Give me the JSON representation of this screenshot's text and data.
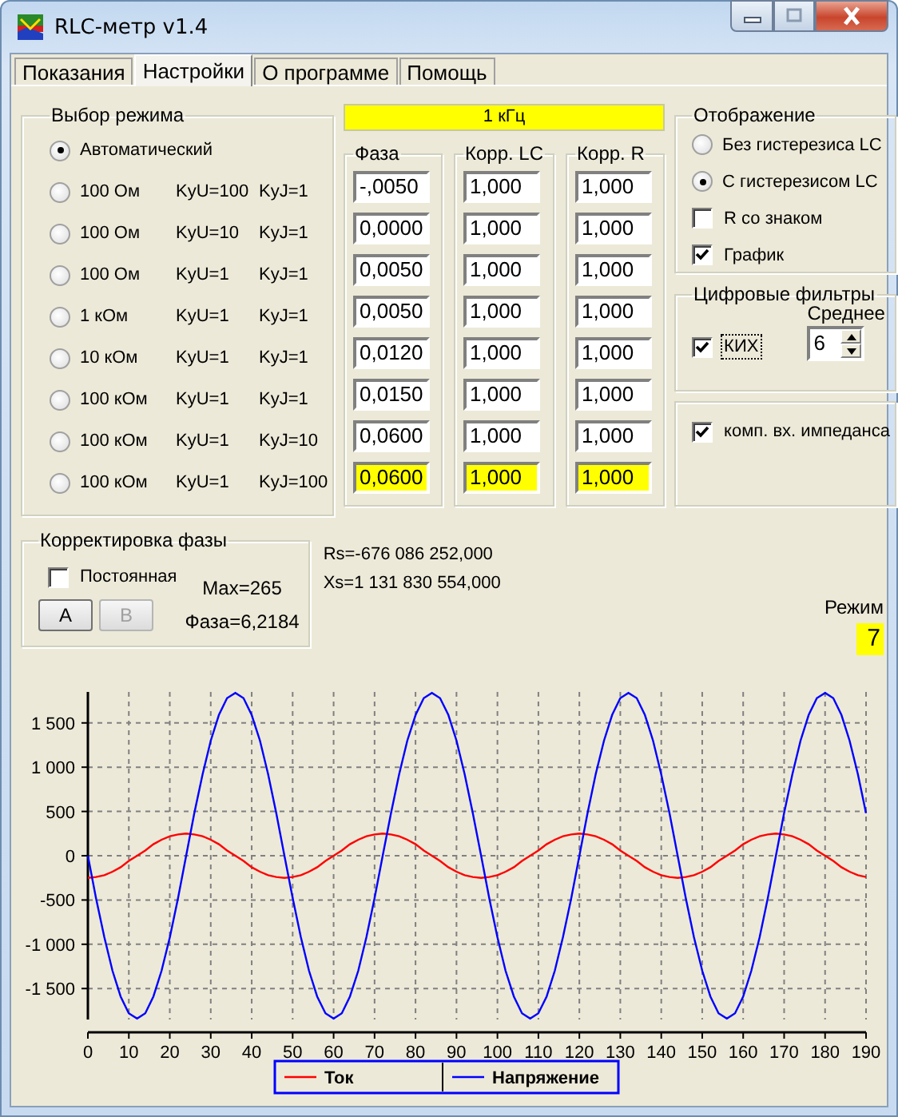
{
  "window": {
    "title": "RLC-метр v1.4"
  },
  "tabs": [
    {
      "label": "Показания",
      "selected": false
    },
    {
      "label": "Настройки",
      "selected": true
    },
    {
      "label": "О программе",
      "selected": false
    },
    {
      "label": "Помощь",
      "selected": false
    }
  ],
  "mode_group": {
    "title": "Выбор режима",
    "options": [
      {
        "parts": [
          "Автоматический"
        ],
        "selected": true
      },
      {
        "parts": [
          "100 Ом",
          "KyU=100",
          "KyJ=1"
        ],
        "selected": false
      },
      {
        "parts": [
          "100 Ом",
          "KyU=10",
          "KyJ=1"
        ],
        "selected": false
      },
      {
        "parts": [
          "100 Ом",
          "KyU=1",
          "KyJ=1"
        ],
        "selected": false
      },
      {
        "parts": [
          "1 кОм",
          "KyU=1",
          "KyJ=1"
        ],
        "selected": false
      },
      {
        "parts": [
          "10 кОм",
          "KyU=1",
          "KyJ=1"
        ],
        "selected": false
      },
      {
        "parts": [
          "100 кОм",
          "KyU=1",
          "KyJ=1"
        ],
        "selected": false
      },
      {
        "parts": [
          "100 кОм",
          "KyU=1",
          "KyJ=10"
        ],
        "selected": false
      },
      {
        "parts": [
          "100 кОм",
          "KyU=1",
          "KyJ=100"
        ],
        "selected": false
      }
    ]
  },
  "frequency": "1 кГц",
  "coefficient_groups": [
    {
      "title": "Фаза",
      "values": [
        {
          "value": "-,0050",
          "highlighted": false
        },
        {
          "value": "0,0000",
          "highlighted": false
        },
        {
          "value": "0,0050",
          "highlighted": false
        },
        {
          "value": "0,0050",
          "highlighted": false
        },
        {
          "value": "0,0120",
          "highlighted": false
        },
        {
          "value": "0,0150",
          "highlighted": false
        },
        {
          "value": "0,0600",
          "highlighted": false
        },
        {
          "value": "0,0600",
          "highlighted": true
        }
      ]
    },
    {
      "title": "Корр. LC",
      "values": [
        {
          "value": "1,000",
          "highlighted": false
        },
        {
          "value": "1,000",
          "highlighted": false
        },
        {
          "value": "1,000",
          "highlighted": false
        },
        {
          "value": "1,000",
          "highlighted": false
        },
        {
          "value": "1,000",
          "highlighted": false
        },
        {
          "value": "1,000",
          "highlighted": false
        },
        {
          "value": "1,000",
          "highlighted": false
        },
        {
          "value": "1,000",
          "highlighted": true
        }
      ]
    },
    {
      "title": "Корр. R",
      "values": [
        {
          "value": "1,000",
          "highlighted": false
        },
        {
          "value": "1,000",
          "highlighted": false
        },
        {
          "value": "1,000",
          "highlighted": false
        },
        {
          "value": "1,000",
          "highlighted": false
        },
        {
          "value": "1,000",
          "highlighted": false
        },
        {
          "value": "1,000",
          "highlighted": false
        },
        {
          "value": "1,000",
          "highlighted": false
        },
        {
          "value": "1,000",
          "highlighted": true
        }
      ]
    }
  ],
  "display_group": {
    "title": "Отображение",
    "options": [
      {
        "kind": "radio",
        "label": "Без гистерезиса LC",
        "selected": false
      },
      {
        "kind": "radio",
        "label": "С гистерезисом LC",
        "selected": true
      },
      {
        "kind": "checkbox",
        "label": "R со знаком",
        "checked": false
      },
      {
        "kind": "checkbox",
        "label": "График",
        "checked": true
      }
    ]
  },
  "filters_group": {
    "title": "Цифровые фильтры",
    "fir": {
      "label": "КИХ",
      "checked": true,
      "focused": true
    },
    "average": {
      "label": "Среднее",
      "value": "6"
    }
  },
  "impedance": {
    "label": "комп. вх. импеданса",
    "checked": true
  },
  "phase_correction": {
    "title": "Корректировка фазы",
    "constant": {
      "label": "Постоянная",
      "checked": false
    },
    "buttons": [
      {
        "label": "A",
        "disabled": false
      },
      {
        "label": "B",
        "disabled": true
      }
    ],
    "max": "Max=265",
    "phase": "Фаза=6,2184"
  },
  "results": [
    "Rs=-676 086 252,000",
    "Xs=1 131 830 554,000"
  ],
  "mode": {
    "label": "Режим",
    "value": "7"
  },
  "chart": {
    "chart_data": {
      "type": "line",
      "x": [
        0,
        2,
        4,
        6,
        8,
        10,
        12,
        14,
        16,
        18,
        20,
        22,
        24,
        26,
        28,
        30,
        32,
        34,
        36,
        38,
        40,
        42,
        44,
        46,
        48,
        50,
        52,
        54,
        56,
        58,
        60,
        62,
        64,
        66,
        68,
        70,
        72,
        74,
        76,
        78,
        80,
        82,
        84,
        86,
        88,
        90,
        92,
        94,
        96,
        98,
        100,
        102,
        104,
        106,
        108,
        110,
        112,
        114,
        116,
        118,
        120,
        122,
        124,
        126,
        128,
        130,
        132,
        134,
        136,
        138,
        140,
        142,
        144,
        146,
        148,
        150,
        152,
        154,
        156,
        158,
        160,
        162,
        164,
        166,
        168,
        170,
        172,
        174,
        176,
        178,
        180,
        182,
        184,
        186,
        188,
        190
      ],
      "series": [
        {
          "name": "Ток",
          "color": "#ff0000",
          "values": [
            -250,
            -240,
            -220,
            -180,
            -130,
            -60,
            0,
            60,
            130,
            180,
            220,
            240,
            250,
            240,
            220,
            180,
            130,
            60,
            0,
            -60,
            -130,
            -180,
            -220,
            -240,
            -250,
            -240,
            -220,
            -180,
            -130,
            -60,
            0,
            60,
            130,
            180,
            220,
            240,
            250,
            240,
            220,
            180,
            130,
            60,
            0,
            -60,
            -130,
            -180,
            -220,
            -240,
            -250,
            -240,
            -220,
            -180,
            -130,
            -60,
            0,
            60,
            130,
            180,
            220,
            240,
            250,
            240,
            220,
            180,
            130,
            60,
            0,
            -60,
            -130,
            -180,
            -220,
            -240,
            -250,
            -240,
            -220,
            -180,
            -130,
            -60,
            0,
            60,
            130,
            180,
            220,
            240,
            250,
            240,
            220,
            180,
            130,
            60,
            0,
            -60,
            -130,
            -180,
            -220,
            -240
          ]
        },
        {
          "name": "Напряжение",
          "color": "#0000ff",
          "values": [
            0,
            -480,
            -920,
            -1300,
            -1590,
            -1780,
            -1840,
            -1780,
            -1590,
            -1300,
            -920,
            -480,
            0,
            480,
            920,
            1300,
            1590,
            1780,
            1840,
            1780,
            1590,
            1300,
            920,
            480,
            0,
            -480,
            -920,
            -1300,
            -1590,
            -1780,
            -1840,
            -1780,
            -1590,
            -1300,
            -920,
            -480,
            0,
            480,
            920,
            1300,
            1590,
            1780,
            1840,
            1780,
            1590,
            1300,
            920,
            480,
            0,
            -480,
            -920,
            -1300,
            -1590,
            -1780,
            -1840,
            -1780,
            -1590,
            -1300,
            -920,
            -480,
            0,
            480,
            920,
            1300,
            1590,
            1780,
            1840,
            1780,
            1590,
            1300,
            920,
            480,
            0,
            -480,
            -920,
            -1300,
            -1590,
            -1780,
            -1840,
            -1780,
            -1590,
            -1300,
            -920,
            -480,
            0,
            480,
            920,
            1300,
            1590,
            1780,
            1840,
            1780,
            1590,
            1300,
            920,
            480
          ]
        }
      ],
      "grid": true,
      "legend": true,
      "xlim": [
        0,
        190
      ],
      "ylim": [
        -1850,
        1850
      ],
      "xticks": [
        0,
        10,
        20,
        30,
        40,
        50,
        60,
        70,
        80,
        90,
        100,
        110,
        120,
        130,
        140,
        150,
        160,
        170,
        180,
        190
      ],
      "yticks": [
        {
          "value": -1500,
          "label": "-1 500"
        },
        {
          "value": -1000,
          "label": "-1 000"
        },
        {
          "value": -500,
          "label": "-500"
        },
        {
          "value": 0,
          "label": "0"
        },
        {
          "value": 500,
          "label": "500"
        },
        {
          "value": 1000,
          "label": "1 000"
        },
        {
          "value": 1500,
          "label": "1 500"
        }
      ]
    }
  }
}
